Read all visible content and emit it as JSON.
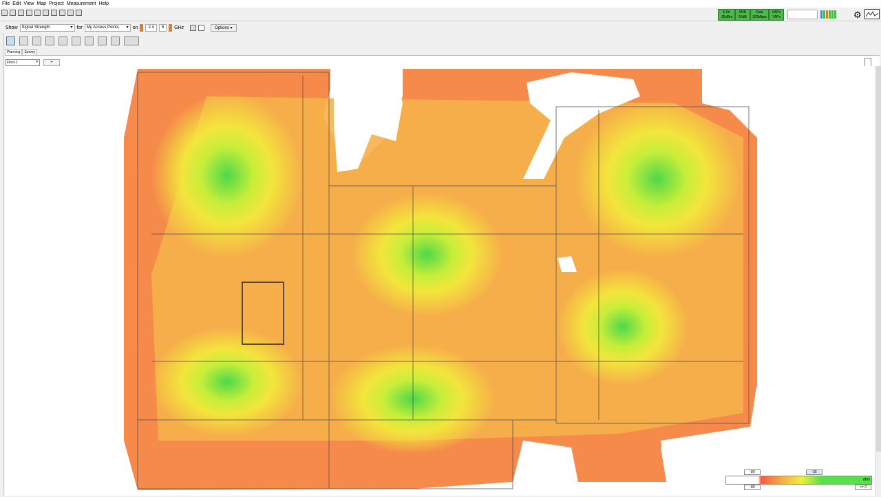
{
  "menu": [
    "File",
    "Edit",
    "View",
    "Map",
    "Project",
    "Measurement",
    "Help"
  ],
  "stats": [
    {
      "label": "S.Str",
      "value": "-35dBm"
    },
    {
      "label": "SNR",
      "value": "59dB"
    },
    {
      "label": "Data",
      "value": "300Mbps"
    },
    {
      "label": "#APs",
      "value": "7APs"
    }
  ],
  "toolbar2": {
    "show_label": "Show",
    "show_value": "Signal Strength",
    "for_label": "for",
    "for_value": "My Access Points",
    "on_label": "on",
    "band1": "2.4",
    "band2": "5",
    "ghz": "GHz",
    "options": "Options"
  },
  "tabs": [
    "Planning",
    "Survey"
  ],
  "floor": {
    "value": "Floor 1",
    "add": "+"
  },
  "legend": {
    "min": "-80",
    "max": "-35",
    "unit": "dBm",
    "lower": "-80",
    "upper": ">= 0"
  },
  "colors": {
    "green": "#4cb84c",
    "accent": "#e27d2a"
  }
}
